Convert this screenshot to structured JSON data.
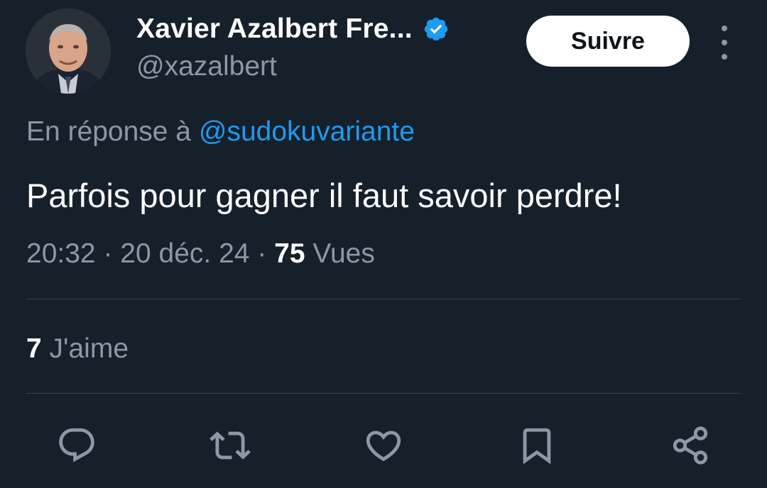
{
  "author": {
    "display_name": "Xavier Azalbert Fre...",
    "handle": "@xazalbert",
    "verified_icon": "verified-badge-icon",
    "avatar": "avatar-photo"
  },
  "header": {
    "follow_label": "Suivre",
    "more_icon": "more-options-icon"
  },
  "reply": {
    "prefix": "En réponse à",
    "mention": "@sudokuvariante"
  },
  "tweet": {
    "text": "Parfois pour gagner il faut savoir perdre!"
  },
  "meta": {
    "time": "20:32",
    "separator": "·",
    "date": "20 déc. 24",
    "views_count": "75",
    "views_label": "Vues"
  },
  "stats": {
    "likes_count": "7",
    "likes_label": "J'aime"
  },
  "actions": [
    {
      "icon": "reply-icon"
    },
    {
      "icon": "retweet-icon"
    },
    {
      "icon": "like-icon"
    },
    {
      "icon": "bookmark-icon"
    },
    {
      "icon": "share-icon"
    }
  ],
  "colors": {
    "background": "#15202b",
    "text_primary": "#ffffff",
    "text_secondary": "#8b98a5",
    "accent": "#1d9bf0",
    "divider": "#38444d"
  }
}
